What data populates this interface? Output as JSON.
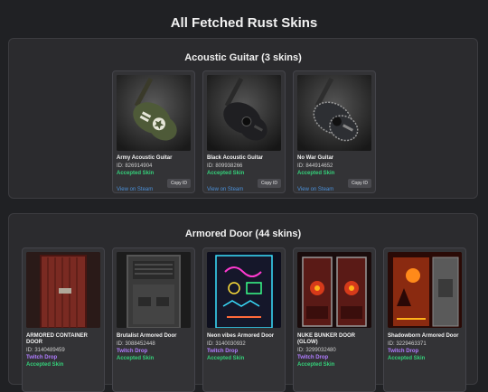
{
  "page": {
    "title": "All Fetched Rust Skins"
  },
  "sections": [
    {
      "title": "Acoustic Guitar (3 skins)",
      "cards": [
        {
          "name": "Army Acoustic Guitar",
          "id": "ID: 826914904",
          "status": "Accepted Skin",
          "steam_label": "View on Steam",
          "copy_label": "Copy ID"
        },
        {
          "name": "Black Acoustic Guitar",
          "id": "ID: 809938266",
          "status": "Accepted Skin",
          "steam_label": "View on Steam",
          "copy_label": "Copy ID"
        },
        {
          "name": "No War Guitar",
          "id": "ID: 844914652",
          "status": "Accepted Skin",
          "steam_label": "View on Steam",
          "copy_label": "Copy ID"
        }
      ]
    },
    {
      "title": "Armored Door (44 skins)",
      "cards": [
        {
          "name": "ARMORED CONTAINER DOOR",
          "id": "ID: 3140489459",
          "drop": "Twitch Drop",
          "status": "Accepted Skin"
        },
        {
          "name": "Brutalist Armored Door",
          "id": "ID: 3088452448",
          "drop": "Twitch Drop",
          "status": "Accepted Skin"
        },
        {
          "name": "Neon vibes Armored Door",
          "id": "ID: 3140030932",
          "drop": "Twitch Drop",
          "status": "Accepted Skin"
        },
        {
          "name": "NUKE BUNKER DOOR (GLOW)",
          "id": "ID: 3299032480",
          "drop": "Twitch Drop",
          "status": "Accepted Skin"
        },
        {
          "name": "Shadowborn Armored Door",
          "id": "ID: 3229463371",
          "drop": "Twitch Drop",
          "status": "Accepted Skin"
        }
      ]
    }
  ]
}
